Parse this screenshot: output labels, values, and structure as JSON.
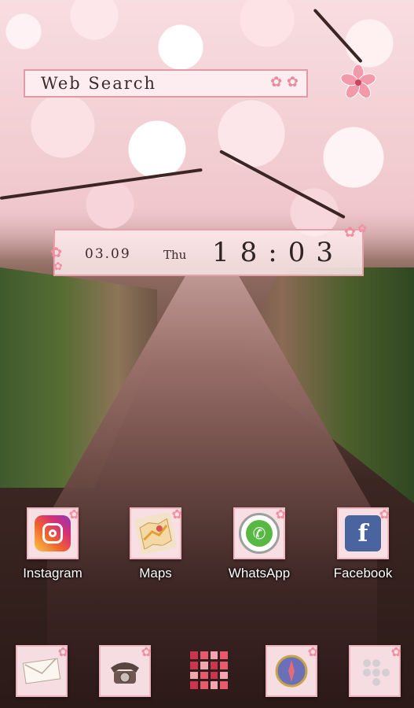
{
  "search": {
    "label": "Web Search"
  },
  "clock": {
    "date": "03.09",
    "day": "Thu",
    "time": "18:03"
  },
  "apps": [
    {
      "label": "Instagram",
      "icon": "instagram-icon"
    },
    {
      "label": "Maps",
      "icon": "maps-icon"
    },
    {
      "label": "WhatsApp",
      "icon": "whatsapp-icon"
    },
    {
      "label": "Facebook",
      "icon": "facebook-icon"
    }
  ],
  "dock": [
    {
      "icon": "mail-icon"
    },
    {
      "icon": "phone-icon"
    },
    {
      "icon": "app-drawer-icon"
    },
    {
      "icon": "compass-icon"
    },
    {
      "icon": "dialpad-icon"
    }
  ],
  "colors": {
    "accent": "#f08fa1",
    "frame": "#f7dfe3",
    "border": "#e8a1ac"
  }
}
